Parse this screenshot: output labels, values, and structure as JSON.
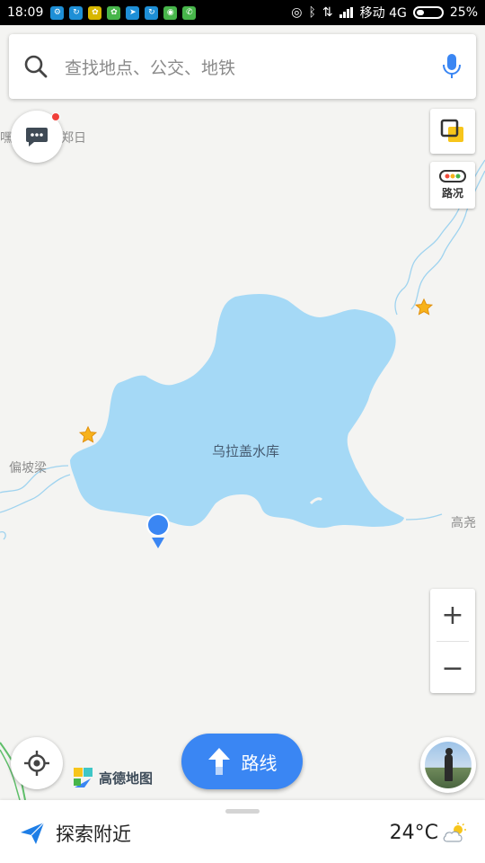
{
  "status_bar": {
    "time": "18:09",
    "carrier": "移动 4G",
    "battery": "25%",
    "notification_icons": [
      "app-icon",
      "app-icon",
      "app-icon",
      "app-icon",
      "telegram-icon",
      "app-icon",
      "app-icon",
      "phone-icon"
    ]
  },
  "search": {
    "placeholder": "查找地点、公交、地铁"
  },
  "map": {
    "lake_name": "乌拉盖水库",
    "labels": {
      "top_left_a": "嘿",
      "top_left_b": "郑日",
      "left": "偏坡梁",
      "right": "高尧"
    },
    "colors": {
      "water": "#a5d9f6",
      "river": "#9fd3ef",
      "land": "#f4f4f2",
      "star": "#f7b21b",
      "marker": "#3a86f3"
    }
  },
  "controls": {
    "traffic_label": "路况",
    "zoom_in": "+",
    "zoom_out": "−",
    "route_label": "路线",
    "logo_text": "高德地图"
  },
  "bottom": {
    "nearby_label": "探索附近",
    "temperature": "24°C"
  }
}
